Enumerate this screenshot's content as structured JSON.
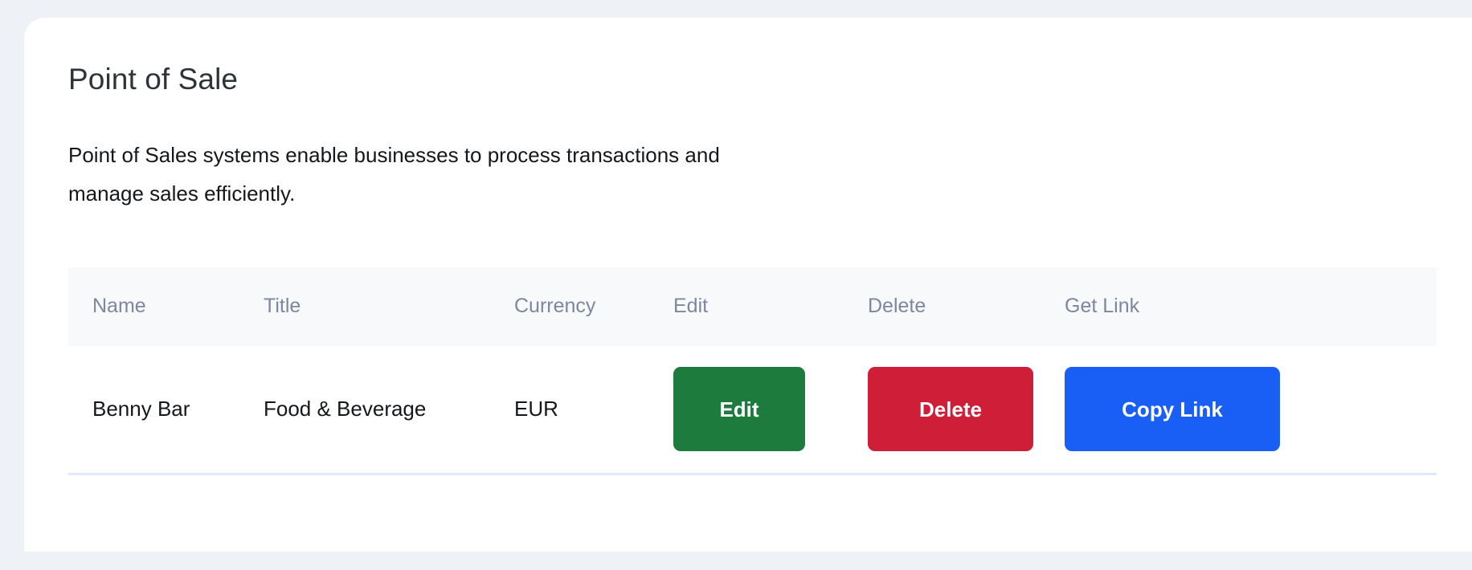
{
  "card": {
    "title": "Point of Sale",
    "description": "Point of Sales systems enable businesses to process transactions and manage sales efficiently."
  },
  "table": {
    "headers": {
      "name": "Name",
      "title": "Title",
      "currency": "Currency",
      "edit": "Edit",
      "delete": "Delete",
      "get_link": "Get Link"
    },
    "rows": [
      {
        "name": "Benny Bar",
        "title": "Food & Beverage",
        "currency": "EUR",
        "edit_label": "Edit",
        "delete_label": "Delete",
        "copy_link_label": "Copy Link"
      }
    ]
  },
  "colors": {
    "page_background": "#eef1f5",
    "card_background": "#ffffff",
    "header_row_background": "#f8f9fa",
    "header_text": "#7c87a0",
    "body_text": "#15181b",
    "title_text": "#2d3338",
    "row_divider": "#dceafb",
    "edit_button": "#1e7b3e",
    "delete_button": "#cf1f38",
    "copy_link_button": "#1a5ff5"
  }
}
